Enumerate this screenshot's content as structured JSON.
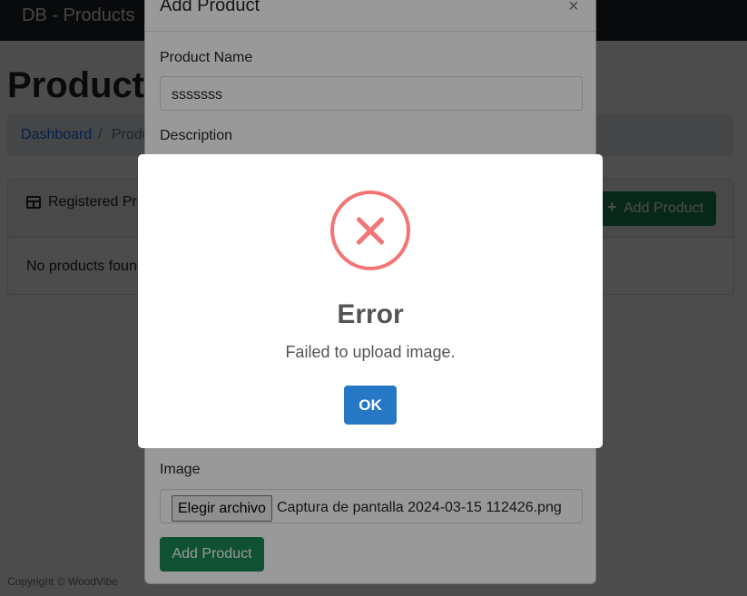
{
  "navbar": {
    "brand": "DB - Products"
  },
  "page": {
    "title": "Products",
    "breadcrumb": {
      "link": "Dashboard",
      "separator": "/",
      "active": "Products"
    }
  },
  "card": {
    "header": "Registered Products",
    "add_button": "Add Product",
    "empty_message": "No products found."
  },
  "footer": {
    "text": "Copyright © WoodVibe"
  },
  "add_modal": {
    "title": "Add Product",
    "close": "×",
    "name_label": "Product Name",
    "name_value": "sssssss",
    "description_label": "Description",
    "image_label": "Image",
    "file_button": "Elegir archivo",
    "file_name": "Captura de pantalla 2024-03-15 112426.png",
    "submit": "Add Product"
  },
  "alert": {
    "icon": "error-icon",
    "title": "Error",
    "message": "Failed to upload image.",
    "confirm": "OK"
  },
  "colors": {
    "navbar": "#212529",
    "primary": "#0d6efd",
    "success": "#198754",
    "error_icon": "#f27474",
    "confirm": "#2778c4"
  }
}
